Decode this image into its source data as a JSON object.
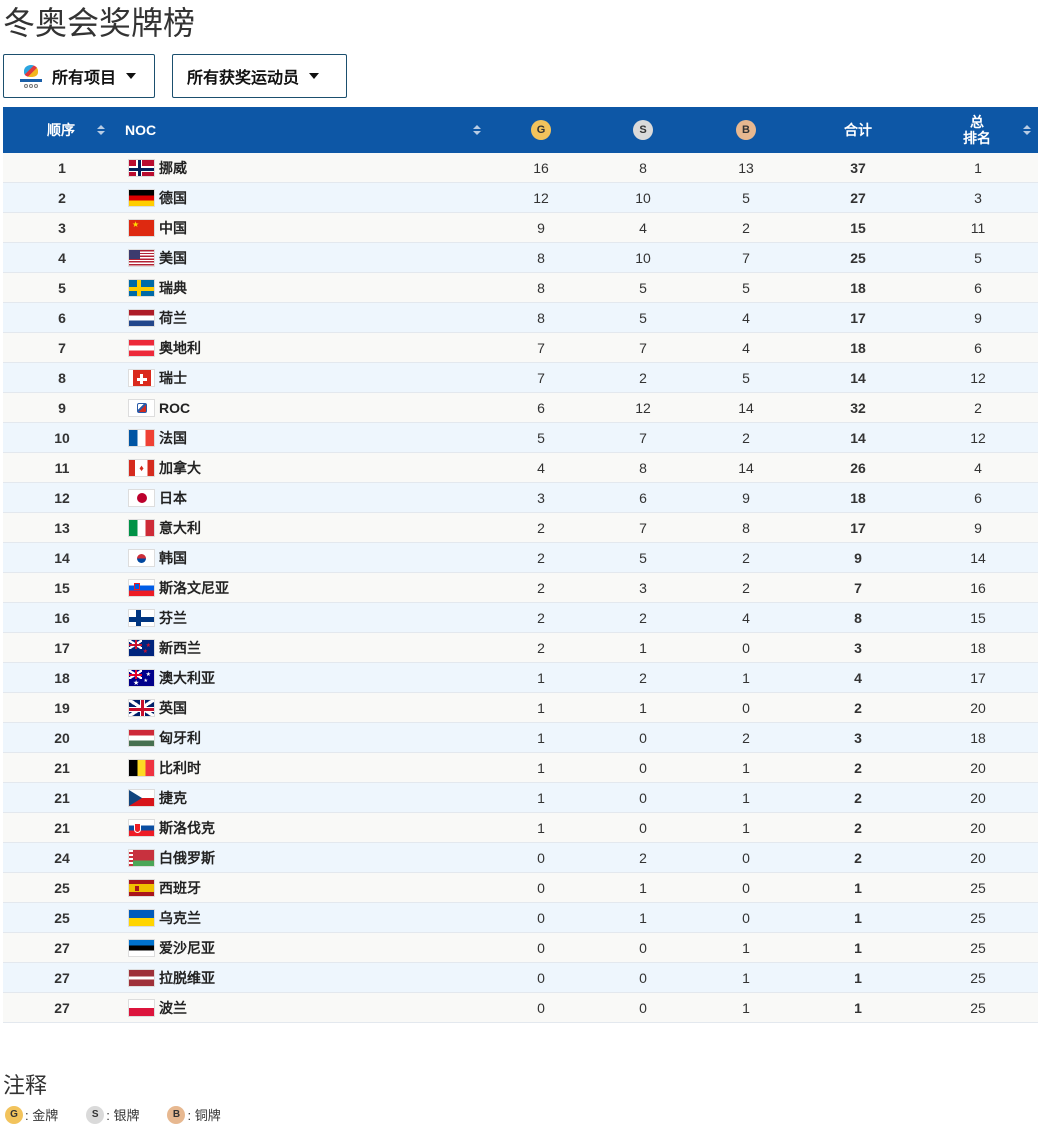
{
  "title": "冬奥会奖牌榜",
  "filters": {
    "events": "所有项目",
    "athletes": "所有获奖运动员"
  },
  "header": {
    "rank": "顺序",
    "noc": "NOC",
    "gold": "G",
    "silver": "S",
    "bronze": "B",
    "total": "合计",
    "total_rank_1": "总",
    "total_rank_2": "排名"
  },
  "rows": [
    {
      "rank": "1",
      "name": "挪威",
      "flag": "norway",
      "g": "16",
      "s": "8",
      "b": "13",
      "t": "37",
      "tr": "1"
    },
    {
      "rank": "2",
      "name": "德国",
      "flag": "germany",
      "g": "12",
      "s": "10",
      "b": "5",
      "t": "27",
      "tr": "3"
    },
    {
      "rank": "3",
      "name": "中国",
      "flag": "china",
      "g": "9",
      "s": "4",
      "b": "2",
      "t": "15",
      "tr": "11"
    },
    {
      "rank": "4",
      "name": "美国",
      "flag": "usa",
      "g": "8",
      "s": "10",
      "b": "7",
      "t": "25",
      "tr": "5"
    },
    {
      "rank": "5",
      "name": "瑞典",
      "flag": "sweden",
      "g": "8",
      "s": "5",
      "b": "5",
      "t": "18",
      "tr": "6"
    },
    {
      "rank": "6",
      "name": "荷兰",
      "flag": "netherlands",
      "g": "8",
      "s": "5",
      "b": "4",
      "t": "17",
      "tr": "9"
    },
    {
      "rank": "7",
      "name": "奥地利",
      "flag": "austria",
      "g": "7",
      "s": "7",
      "b": "4",
      "t": "18",
      "tr": "6"
    },
    {
      "rank": "8",
      "name": "瑞士",
      "flag": "switzerland",
      "g": "7",
      "s": "2",
      "b": "5",
      "t": "14",
      "tr": "12"
    },
    {
      "rank": "9",
      "name": "ROC",
      "flag": "roc",
      "g": "6",
      "s": "12",
      "b": "14",
      "t": "32",
      "tr": "2"
    },
    {
      "rank": "10",
      "name": "法国",
      "flag": "france",
      "g": "5",
      "s": "7",
      "b": "2",
      "t": "14",
      "tr": "12"
    },
    {
      "rank": "11",
      "name": "加拿大",
      "flag": "canada",
      "g": "4",
      "s": "8",
      "b": "14",
      "t": "26",
      "tr": "4"
    },
    {
      "rank": "12",
      "name": "日本",
      "flag": "japan",
      "g": "3",
      "s": "6",
      "b": "9",
      "t": "18",
      "tr": "6"
    },
    {
      "rank": "13",
      "name": "意大利",
      "flag": "italy",
      "g": "2",
      "s": "7",
      "b": "8",
      "t": "17",
      "tr": "9"
    },
    {
      "rank": "14",
      "name": "韩国",
      "flag": "korea",
      "g": "2",
      "s": "5",
      "b": "2",
      "t": "9",
      "tr": "14"
    },
    {
      "rank": "15",
      "name": "斯洛文尼亚",
      "flag": "slovenia",
      "g": "2",
      "s": "3",
      "b": "2",
      "t": "7",
      "tr": "16"
    },
    {
      "rank": "16",
      "name": "芬兰",
      "flag": "finland",
      "g": "2",
      "s": "2",
      "b": "4",
      "t": "8",
      "tr": "15"
    },
    {
      "rank": "17",
      "name": "新西兰",
      "flag": "newzealand",
      "g": "2",
      "s": "1",
      "b": "0",
      "t": "3",
      "tr": "18"
    },
    {
      "rank": "18",
      "name": "澳大利亚",
      "flag": "australia",
      "g": "1",
      "s": "2",
      "b": "1",
      "t": "4",
      "tr": "17"
    },
    {
      "rank": "19",
      "name": "英国",
      "flag": "uk",
      "g": "1",
      "s": "1",
      "b": "0",
      "t": "2",
      "tr": "20"
    },
    {
      "rank": "20",
      "name": "匈牙利",
      "flag": "hungary",
      "g": "1",
      "s": "0",
      "b": "2",
      "t": "3",
      "tr": "18"
    },
    {
      "rank": "21",
      "name": "比利时",
      "flag": "belgium",
      "g": "1",
      "s": "0",
      "b": "1",
      "t": "2",
      "tr": "20"
    },
    {
      "rank": "21",
      "name": "捷克",
      "flag": "czech",
      "g": "1",
      "s": "0",
      "b": "1",
      "t": "2",
      "tr": "20"
    },
    {
      "rank": "21",
      "name": "斯洛伐克",
      "flag": "slovakia",
      "g": "1",
      "s": "0",
      "b": "1",
      "t": "2",
      "tr": "20"
    },
    {
      "rank": "24",
      "name": "白俄罗斯",
      "flag": "belarus",
      "g": "0",
      "s": "2",
      "b": "0",
      "t": "2",
      "tr": "20"
    },
    {
      "rank": "25",
      "name": "西班牙",
      "flag": "spain",
      "g": "0",
      "s": "1",
      "b": "0",
      "t": "1",
      "tr": "25"
    },
    {
      "rank": "25",
      "name": "乌克兰",
      "flag": "ukraine",
      "g": "0",
      "s": "1",
      "b": "0",
      "t": "1",
      "tr": "25"
    },
    {
      "rank": "27",
      "name": "爱沙尼亚",
      "flag": "estonia",
      "g": "0",
      "s": "0",
      "b": "1",
      "t": "1",
      "tr": "25"
    },
    {
      "rank": "27",
      "name": "拉脱维亚",
      "flag": "latvia",
      "g": "0",
      "s": "0",
      "b": "1",
      "t": "1",
      "tr": "25"
    },
    {
      "rank": "27",
      "name": "波兰",
      "flag": "poland",
      "g": "0",
      "s": "0",
      "b": "1",
      "t": "1",
      "tr": "25"
    }
  ],
  "notes": {
    "title": "注释",
    "gold_letter": "G",
    "gold_label": ": 金牌",
    "silver_letter": "S",
    "silver_label": ": 银牌",
    "bronze_letter": "B",
    "bronze_label": ": 铜牌"
  },
  "colors": {
    "header_bg": "#0d57a6",
    "gold": "#f2c35c",
    "silver": "#dadada",
    "bronze": "#e7b890",
    "row_alt": "#eef6fd"
  }
}
